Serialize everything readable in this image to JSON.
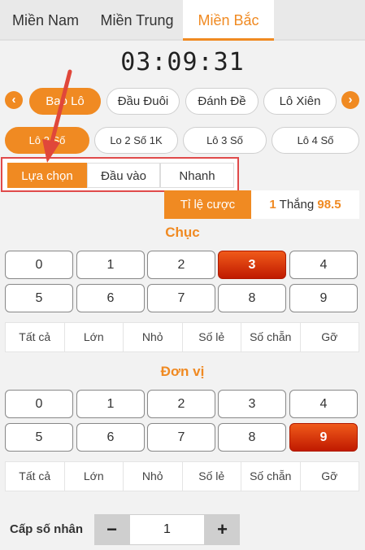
{
  "region_tabs": [
    {
      "label": "Miền Nam"
    },
    {
      "label": "Miền Trung"
    },
    {
      "label": "Miền Bắc",
      "active": true
    }
  ],
  "clock": "03:09:31",
  "bet_types": [
    {
      "label": "Bao Lô",
      "active": true
    },
    {
      "label": "Đầu Đuôi"
    },
    {
      "label": "Đánh Đề"
    },
    {
      "label": "Lô Xiên"
    }
  ],
  "sub_types": [
    {
      "label": "Lô 2 Số",
      "active": true
    },
    {
      "label": "Lo 2 Số 1K"
    },
    {
      "label": "Lô 3 Số"
    },
    {
      "label": "Lô 4 Số"
    }
  ],
  "method_tabs": [
    {
      "label": "Lựa chọn",
      "active": true
    },
    {
      "label": "Đầu vào"
    },
    {
      "label": "Nhanh"
    }
  ],
  "odds": {
    "label": "Tỉ lệ cược",
    "count": "1",
    "text": "Thắng",
    "value": "98.5"
  },
  "chuc": {
    "title": "Chục",
    "numbers": [
      "0",
      "1",
      "2",
      "3",
      "4",
      "5",
      "6",
      "7",
      "8",
      "9"
    ],
    "selected": "3"
  },
  "don_vi": {
    "title": "Đơn vị",
    "numbers": [
      "0",
      "1",
      "2",
      "3",
      "4",
      "5",
      "6",
      "7",
      "8",
      "9"
    ],
    "selected": "9"
  },
  "quick_buttons": [
    "Tất cả",
    "Lớn",
    "Nhỏ",
    "Số lẻ",
    "Số chẵn",
    "Gỡ"
  ],
  "multiplier": {
    "label": "Cấp số nhân",
    "minus": "−",
    "plus": "+",
    "value": "1"
  },
  "icons": {
    "left": "chevron-left-icon",
    "right": "chevron-right-icon"
  },
  "colors": {
    "accent": "#f08a22",
    "selected": "#c01a00",
    "highlight_box": "#e04a4a"
  }
}
